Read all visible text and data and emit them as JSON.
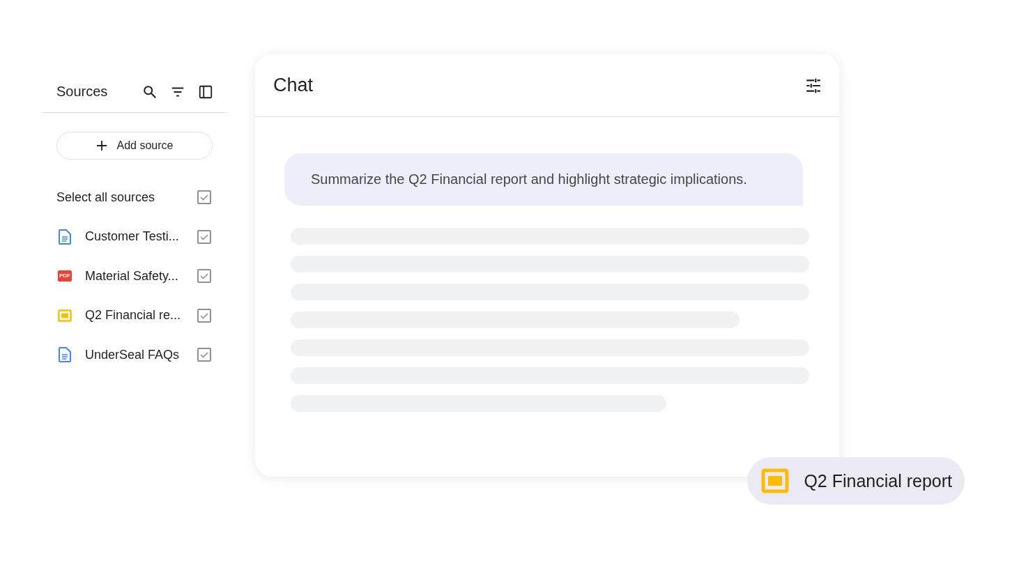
{
  "sources_panel": {
    "title": "Sources",
    "add_button": "Add source",
    "select_all": {
      "label": "Select all sources",
      "checked": true
    },
    "items": [
      {
        "kind": "doc",
        "label": "Customer Testi...",
        "checked": true
      },
      {
        "kind": "pdf",
        "badge": "PDF",
        "label": "Material Safety...",
        "checked": true
      },
      {
        "kind": "slides",
        "label": "Q2 Financial re...",
        "checked": true
      },
      {
        "kind": "doc",
        "label": "UnderSeal FAQs",
        "checked": true
      }
    ]
  },
  "chat": {
    "title": "Chat",
    "prompt": "Summarize the Q2 Financial report and highlight strategic implications."
  },
  "source_chip": {
    "kind": "slides",
    "label": "Q2 Financial report"
  }
}
